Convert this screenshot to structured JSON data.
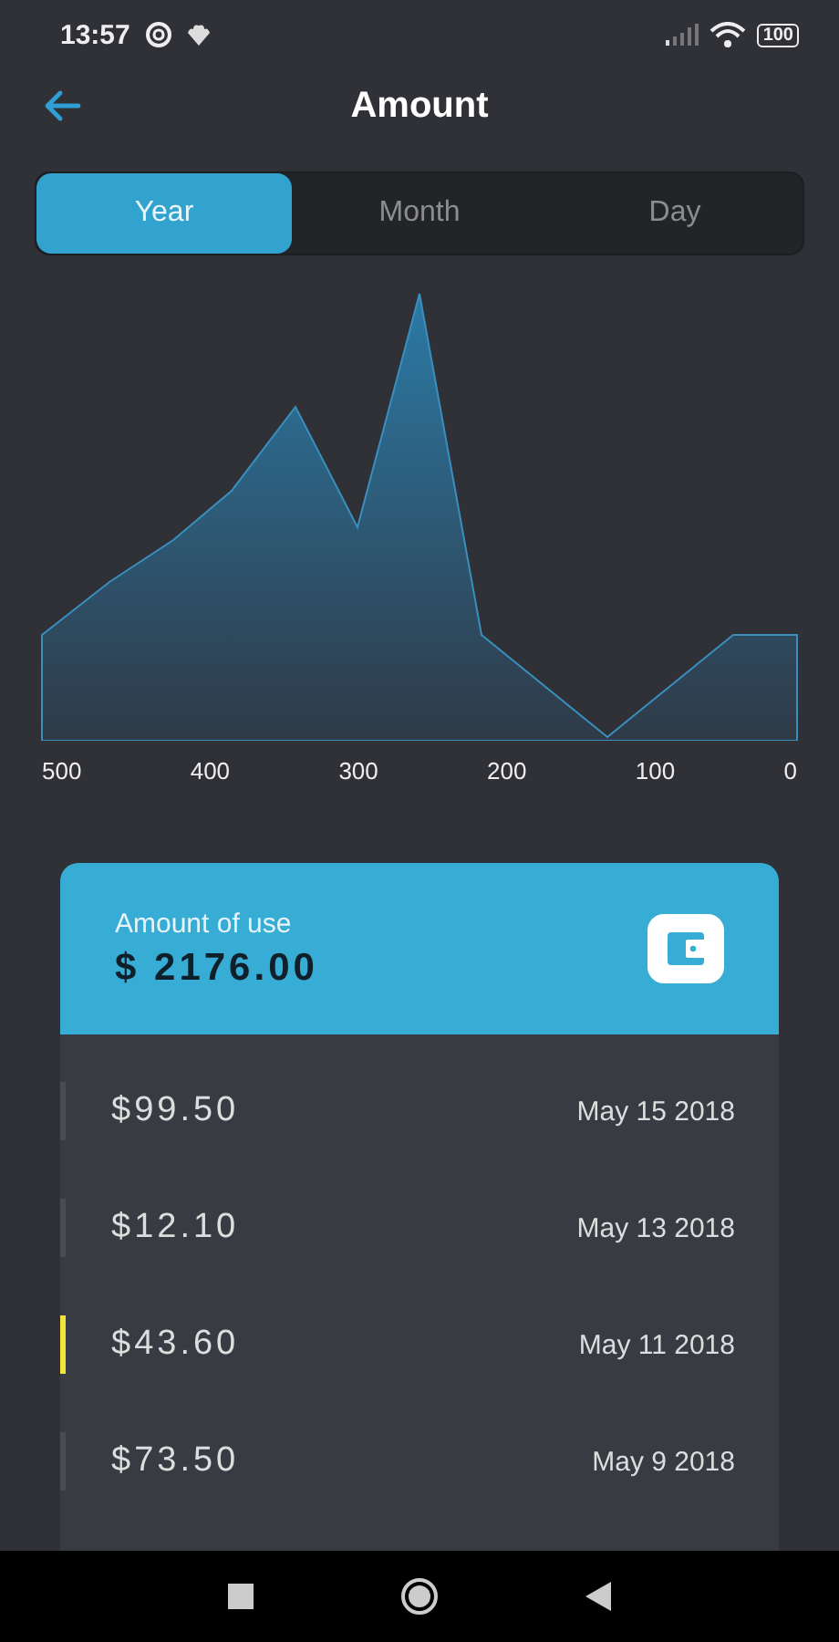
{
  "status_bar": {
    "time": "13:57",
    "battery": "100"
  },
  "header": {
    "title": "Amount"
  },
  "tabs": [
    {
      "label": "Year",
      "selected": true
    },
    {
      "label": "Month",
      "selected": false
    },
    {
      "label": "Day",
      "selected": false
    }
  ],
  "chart": {
    "axis_labels": [
      "500",
      "400",
      "300",
      "200",
      "100",
      "0"
    ]
  },
  "summary_card": {
    "label": "Amount of use",
    "total": "$ 2176.00"
  },
  "transactions": [
    {
      "amount": "$99.50",
      "date": "May 15 2018",
      "selected": false
    },
    {
      "amount": "$12.10",
      "date": "May 13 2018",
      "selected": false
    },
    {
      "amount": "$43.60",
      "date": "May 11 2018",
      "selected": true
    },
    {
      "amount": "$73.50",
      "date": "May 9 2018",
      "selected": false
    }
  ]
}
